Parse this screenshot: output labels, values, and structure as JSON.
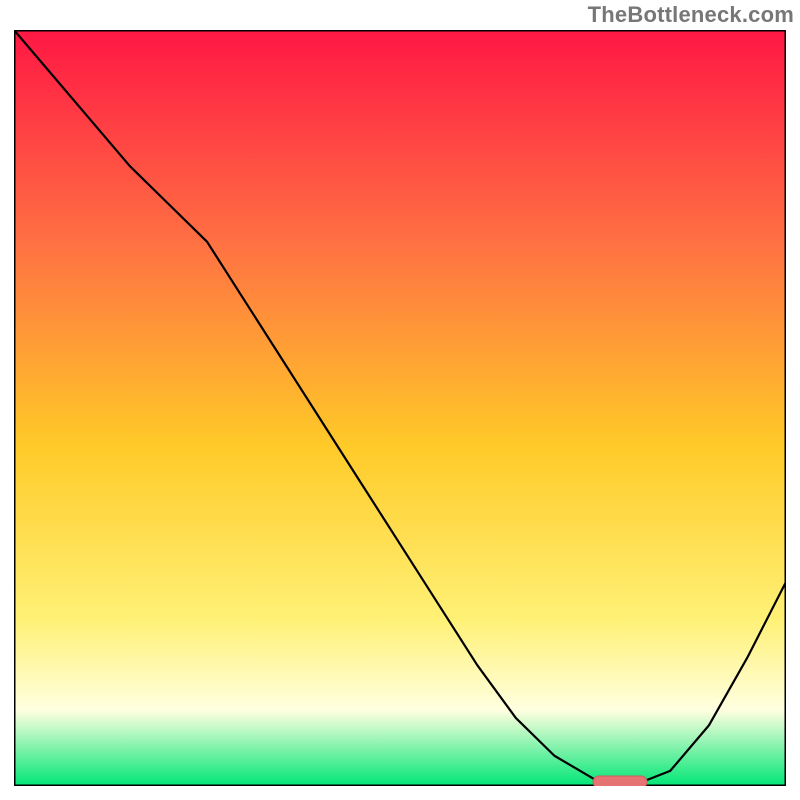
{
  "watermark": "TheBottleneck.com",
  "colors": {
    "gradient_top": "#ff1744",
    "gradient_mid1": "#ff7043",
    "gradient_mid2": "#ffca28",
    "gradient_mid3": "#fff176",
    "gradient_pale": "#ffffe0",
    "gradient_green": "#00e676",
    "border": "#000000",
    "curve": "#000000",
    "marker_fill": "#e57373",
    "marker_stroke": "#d05a5a"
  },
  "chart_data": {
    "type": "line",
    "title": "",
    "xlabel": "",
    "ylabel": "",
    "xlim": [
      0,
      100
    ],
    "ylim": [
      0,
      100
    ],
    "x": [
      0,
      5,
      10,
      15,
      20,
      25,
      30,
      35,
      40,
      45,
      50,
      55,
      60,
      65,
      70,
      75,
      80,
      85,
      90,
      95,
      100
    ],
    "values": [
      100,
      94,
      88,
      82,
      77,
      72,
      64,
      56,
      48,
      40,
      32,
      24,
      16,
      9,
      4,
      1,
      0,
      2,
      8,
      17,
      27
    ],
    "marker": {
      "x_start": 75,
      "x_end": 82,
      "y": 0
    }
  }
}
